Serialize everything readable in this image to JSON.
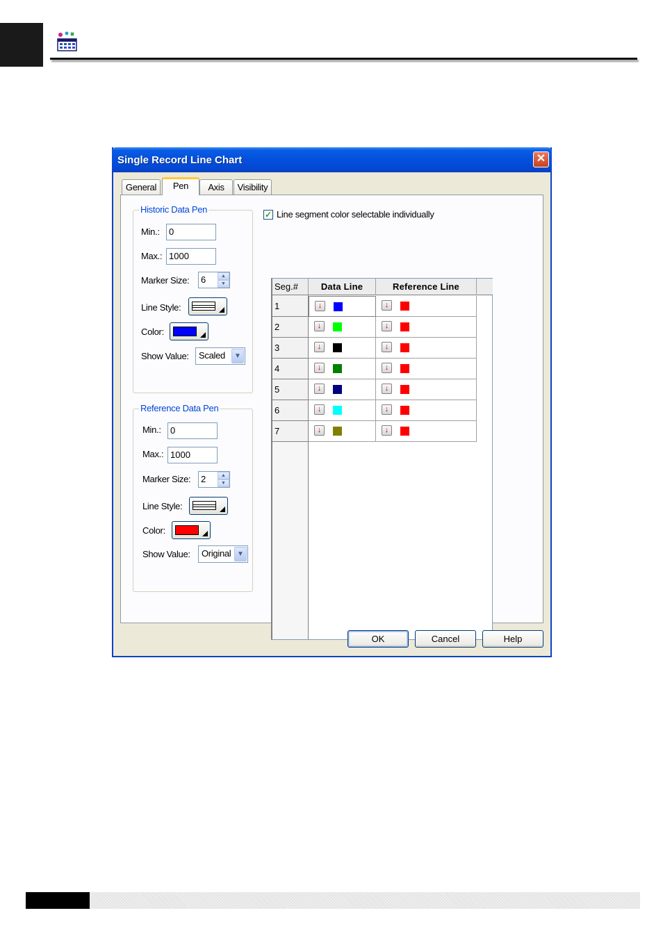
{
  "header": {
    "icon": "line-chart-app-icon"
  },
  "dialog": {
    "title": "Single Record Line Chart",
    "close_label": "✕",
    "tabs": [
      {
        "label": "General",
        "active": false
      },
      {
        "label": "Pen",
        "active": true
      },
      {
        "label": "Axis",
        "active": false
      },
      {
        "label": "Visibility",
        "active": false
      }
    ],
    "historic_pen": {
      "title": "Historic Data Pen",
      "min_label": "Min.:",
      "min_value": "0",
      "max_label": "Max.:",
      "max_value": "1000",
      "marker_label": "Marker Size:",
      "marker_value": "6",
      "line_style_label": "Line Style:",
      "color_label": "Color:",
      "color": "#0000ff",
      "show_value_label": "Show Value:",
      "show_value": "Scaled"
    },
    "reference_pen": {
      "title": "Reference Data Pen",
      "min_label": "Min.:",
      "min_value": "0",
      "max_label": "Max.:",
      "max_value": "1000",
      "marker_label": "Marker Size:",
      "marker_value": "2",
      "line_style_label": "Line Style:",
      "color_label": "Color:",
      "color": "#ff0000",
      "show_value_label": "Show Value:",
      "show_value": "Original"
    },
    "segment_checkbox": {
      "label": "Line segment color selectable individually",
      "checked": true
    },
    "grid": {
      "headers": [
        "Seg.#",
        "Data Line",
        "Reference Line"
      ],
      "rows": [
        {
          "seg": "1",
          "data_color": "#0000ff",
          "ref_color": "#ff0000"
        },
        {
          "seg": "2",
          "data_color": "#00ff00",
          "ref_color": "#ff0000"
        },
        {
          "seg": "3",
          "data_color": "#000000",
          "ref_color": "#ff0000"
        },
        {
          "seg": "4",
          "data_color": "#008000",
          "ref_color": "#ff0000"
        },
        {
          "seg": "5",
          "data_color": "#000080",
          "ref_color": "#ff0000"
        },
        {
          "seg": "6",
          "data_color": "#00ffff",
          "ref_color": "#ff0000"
        },
        {
          "seg": "7",
          "data_color": "#808000",
          "ref_color": "#ff0000"
        }
      ]
    },
    "buttons": {
      "ok": "OK",
      "cancel": "Cancel",
      "help": "Help"
    }
  }
}
